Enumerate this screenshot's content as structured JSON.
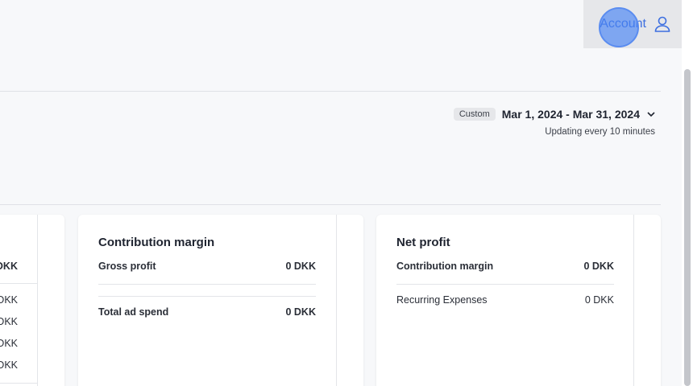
{
  "header": {
    "account_label": "Account",
    "account_icon": "user-icon"
  },
  "date_filter": {
    "badge": "Custom",
    "range": "Mar 1, 2024 - Mar 31, 2024",
    "update_note": "Updating every 10 minutes"
  },
  "left_card": {
    "values": [
      "DKK",
      "DKK",
      "DKK",
      "DKK",
      "DKK"
    ]
  },
  "contribution_card": {
    "title": "Contribution margin",
    "rows": [
      {
        "label": "Gross profit",
        "value": "0 DKK"
      },
      {
        "label": "Total ad spend",
        "value": "0 DKK"
      }
    ]
  },
  "net_profit_card": {
    "title": "Net profit",
    "rows": [
      {
        "label": "Contribution margin",
        "value": "0 DKK"
      },
      {
        "label": "Recurring Expenses",
        "value": "0 DKK"
      }
    ]
  }
}
